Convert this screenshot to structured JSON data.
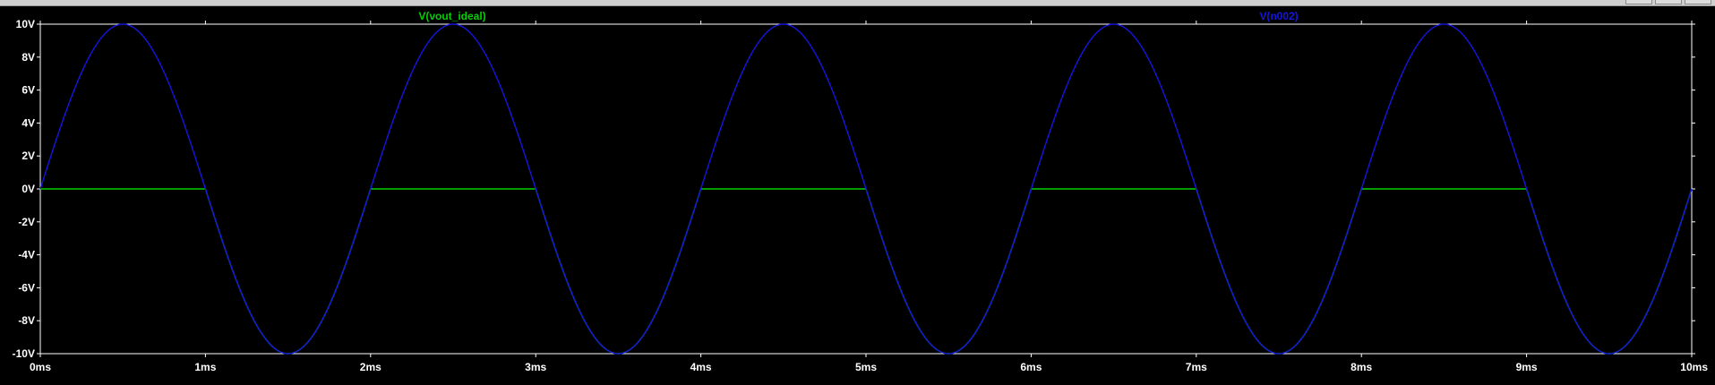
{
  "window": {
    "controls": [
      "minimize-button",
      "maximize-button",
      "close-button"
    ]
  },
  "chart_data": {
    "type": "line",
    "xlabel": "",
    "ylabel": "",
    "xlim": [
      0,
      10
    ],
    "ylim": [
      -10,
      10
    ],
    "x_unit": "ms",
    "y_unit": "V",
    "grid": false,
    "x_ticks": [
      0,
      1,
      2,
      3,
      4,
      5,
      6,
      7,
      8,
      9,
      10
    ],
    "x_tick_labels": [
      "0ms",
      "1ms",
      "2ms",
      "3ms",
      "4ms",
      "5ms",
      "6ms",
      "7ms",
      "8ms",
      "9ms",
      "10ms"
    ],
    "y_ticks": [
      10,
      8,
      6,
      4,
      2,
      0,
      -2,
      -4,
      -6,
      -8,
      -10
    ],
    "y_tick_labels": [
      "10V",
      "8V",
      "6V",
      "4V",
      "2V",
      "0V",
      "-2V",
      "-4V",
      "-6V",
      "-8V",
      "-10V"
    ],
    "series": [
      {
        "name": "V(vout_ideal)",
        "color": "#00d000",
        "x": [
          0,
          0.5,
          1,
          1.5,
          2,
          2.5,
          3,
          3.5,
          4,
          4.5,
          5,
          5.5,
          6,
          6.5,
          7,
          7.5,
          8,
          8.5,
          9,
          9.5,
          10
        ],
        "y": [
          0,
          0,
          0,
          -10,
          0,
          0,
          0,
          -10,
          0,
          0,
          0,
          -10,
          0,
          0,
          0,
          -10,
          0,
          0,
          0,
          -10,
          0
        ],
        "description": "0 V for the first half of each 2 ms period, follows the negative sine half-cycle otherwise"
      },
      {
        "name": "V(n002)",
        "color": "#1515e0",
        "x": [
          0,
          0.5,
          1,
          1.5,
          2,
          2.5,
          3,
          3.5,
          4,
          4.5,
          5,
          5.5,
          6,
          6.5,
          7,
          7.5,
          8,
          8.5,
          9,
          9.5,
          10
        ],
        "y": [
          0,
          10,
          0,
          -10,
          0,
          10,
          0,
          -10,
          0,
          10,
          0,
          -10,
          0,
          10,
          0,
          -10,
          0,
          10,
          0,
          -10,
          0
        ],
        "amplitude": 10,
        "frequency_hz": 500
      }
    ]
  }
}
